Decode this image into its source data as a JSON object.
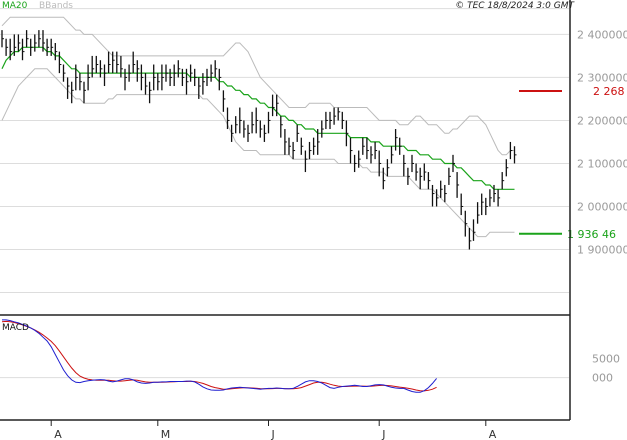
{
  "header": {
    "ma_label": "MA20",
    "bands_label": "BBands",
    "copyright": "© TEC 18/8/2024 3:0 GMT"
  },
  "colors": {
    "ma": "#1aa31a",
    "bands": "#bbbbbb",
    "bars": "#111111",
    "grid": "#dddddd",
    "axis": "#222222",
    "macd_line": "#1f1fd0",
    "macd_signal": "#cc1111",
    "hi_marker": "#cc1111",
    "lo_marker": "#1aa31a"
  },
  "markers": {
    "high_value": 2.2685,
    "high_label": "2 268 5",
    "low_value": 1.93646,
    "low_label": "1 936 46"
  },
  "chart_data": [
    {
      "type": "ohlc",
      "title": "",
      "ylim": [
        1.75,
        2.48
      ],
      "yticks": [
        1.9,
        2.0,
        2.1,
        2.2,
        2.3,
        2.4
      ],
      "ytick_labels": [
        "1 900000",
        "2 000000",
        "2 100000",
        "2 200000",
        "2 300000",
        "2 400000"
      ],
      "xtick_labels": [
        "A",
        "M",
        "J",
        "J",
        "A"
      ],
      "xtick_index": [
        12,
        38,
        65,
        92,
        118
      ],
      "close": [
        2.39,
        2.37,
        2.36,
        2.37,
        2.38,
        2.36,
        2.39,
        2.37,
        2.38,
        2.39,
        2.38,
        2.37,
        2.37,
        2.36,
        2.33,
        2.31,
        2.28,
        2.27,
        2.3,
        2.29,
        2.27,
        2.3,
        2.32,
        2.33,
        2.32,
        2.31,
        2.33,
        2.34,
        2.33,
        2.32,
        2.3,
        2.31,
        2.33,
        2.32,
        2.3,
        2.28,
        2.27,
        2.3,
        2.29,
        2.3,
        2.31,
        2.3,
        2.31,
        2.32,
        2.3,
        2.29,
        2.31,
        2.3,
        2.28,
        2.29,
        2.3,
        2.31,
        2.32,
        2.3,
        2.25,
        2.2,
        2.17,
        2.19,
        2.2,
        2.18,
        2.17,
        2.19,
        2.2,
        2.18,
        2.17,
        2.2,
        2.23,
        2.24,
        2.19,
        2.15,
        2.14,
        2.13,
        2.17,
        2.14,
        2.11,
        2.13,
        2.14,
        2.15,
        2.18,
        2.2,
        2.2,
        2.21,
        2.22,
        2.2,
        2.17,
        2.13,
        2.1,
        2.11,
        2.14,
        2.13,
        2.12,
        2.13,
        2.1,
        2.06,
        2.09,
        2.12,
        2.16,
        2.14,
        2.1,
        2.07,
        2.1,
        2.08,
        2.07,
        2.08,
        2.06,
        2.03,
        2.02,
        2.04,
        2.03,
        2.07,
        2.1,
        2.05,
        2.0,
        1.96,
        1.92,
        1.94,
        1.98,
        2.01,
        2.0,
        2.02,
        2.03,
        2.02,
        2.06,
        2.09,
        2.13,
        2.12
      ],
      "high": [
        2.41,
        2.39,
        2.39,
        2.4,
        2.4,
        2.39,
        2.41,
        2.39,
        2.4,
        2.41,
        2.41,
        2.39,
        2.39,
        2.38,
        2.36,
        2.33,
        2.3,
        2.29,
        2.33,
        2.31,
        2.29,
        2.33,
        2.35,
        2.35,
        2.34,
        2.33,
        2.36,
        2.36,
        2.36,
        2.35,
        2.32,
        2.33,
        2.36,
        2.34,
        2.33,
        2.31,
        2.29,
        2.33,
        2.31,
        2.33,
        2.33,
        2.32,
        2.33,
        2.34,
        2.32,
        2.32,
        2.33,
        2.32,
        2.3,
        2.31,
        2.32,
        2.33,
        2.34,
        2.32,
        2.27,
        2.23,
        2.19,
        2.21,
        2.23,
        2.2,
        2.19,
        2.22,
        2.23,
        2.2,
        2.19,
        2.22,
        2.26,
        2.26,
        2.21,
        2.18,
        2.16,
        2.15,
        2.19,
        2.16,
        2.13,
        2.15,
        2.16,
        2.18,
        2.2,
        2.22,
        2.22,
        2.23,
        2.23,
        2.22,
        2.2,
        2.16,
        2.12,
        2.13,
        2.16,
        2.16,
        2.14,
        2.15,
        2.13,
        2.09,
        2.11,
        2.14,
        2.18,
        2.16,
        2.12,
        2.09,
        2.12,
        2.1,
        2.09,
        2.1,
        2.08,
        2.05,
        2.04,
        2.06,
        2.05,
        2.09,
        2.12,
        2.08,
        2.03,
        1.99,
        1.95,
        1.97,
        2.01,
        2.03,
        2.02,
        2.04,
        2.05,
        2.04,
        2.08,
        2.11,
        2.15,
        2.14
      ],
      "low": [
        2.37,
        2.35,
        2.34,
        2.35,
        2.36,
        2.34,
        2.37,
        2.35,
        2.36,
        2.37,
        2.36,
        2.35,
        2.35,
        2.34,
        2.31,
        2.29,
        2.25,
        2.24,
        2.27,
        2.27,
        2.24,
        2.27,
        2.3,
        2.31,
        2.3,
        2.28,
        2.31,
        2.31,
        2.31,
        2.3,
        2.27,
        2.29,
        2.31,
        2.29,
        2.27,
        2.26,
        2.24,
        2.27,
        2.27,
        2.27,
        2.29,
        2.28,
        2.28,
        2.3,
        2.28,
        2.26,
        2.29,
        2.28,
        2.25,
        2.26,
        2.28,
        2.29,
        2.3,
        2.27,
        2.22,
        2.18,
        2.15,
        2.17,
        2.17,
        2.16,
        2.15,
        2.17,
        2.17,
        2.16,
        2.15,
        2.17,
        2.21,
        2.21,
        2.16,
        2.12,
        2.12,
        2.11,
        2.15,
        2.12,
        2.08,
        2.11,
        2.12,
        2.12,
        2.16,
        2.18,
        2.18,
        2.19,
        2.2,
        2.18,
        2.14,
        2.1,
        2.08,
        2.09,
        2.12,
        2.11,
        2.1,
        2.11,
        2.07,
        2.04,
        2.07,
        2.1,
        2.13,
        2.12,
        2.07,
        2.05,
        2.08,
        2.06,
        2.04,
        2.06,
        2.04,
        2.0,
        2.0,
        2.02,
        2.01,
        2.05,
        2.08,
        2.02,
        1.98,
        1.93,
        1.9,
        1.92,
        1.96,
        1.98,
        1.98,
        2.0,
        2.01,
        2.0,
        2.04,
        2.07,
        2.11,
        2.1
      ],
      "ma20": [
        2.32,
        2.34,
        2.35,
        2.36,
        2.36,
        2.37,
        2.37,
        2.37,
        2.37,
        2.37,
        2.37,
        2.36,
        2.36,
        2.35,
        2.35,
        2.34,
        2.33,
        2.32,
        2.32,
        2.31,
        2.31,
        2.31,
        2.31,
        2.31,
        2.31,
        2.31,
        2.31,
        2.31,
        2.31,
        2.31,
        2.31,
        2.31,
        2.31,
        2.31,
        2.31,
        2.31,
        2.31,
        2.31,
        2.31,
        2.31,
        2.31,
        2.31,
        2.31,
        2.31,
        2.31,
        2.31,
        2.3,
        2.3,
        2.3,
        2.3,
        2.3,
        2.3,
        2.3,
        2.29,
        2.29,
        2.28,
        2.28,
        2.27,
        2.27,
        2.26,
        2.26,
        2.25,
        2.25,
        2.24,
        2.24,
        2.23,
        2.23,
        2.22,
        2.21,
        2.21,
        2.2,
        2.2,
        2.19,
        2.19,
        2.18,
        2.18,
        2.18,
        2.17,
        2.17,
        2.17,
        2.17,
        2.17,
        2.17,
        2.17,
        2.17,
        2.16,
        2.16,
        2.16,
        2.16,
        2.16,
        2.15,
        2.15,
        2.15,
        2.14,
        2.14,
        2.14,
        2.14,
        2.14,
        2.14,
        2.13,
        2.13,
        2.13,
        2.12,
        2.12,
        2.12,
        2.11,
        2.11,
        2.11,
        2.1,
        2.1,
        2.1,
        2.09,
        2.09,
        2.08,
        2.07,
        2.06,
        2.06,
        2.06,
        2.05,
        2.05,
        2.04,
        2.04,
        2.04,
        2.04,
        2.04,
        2.04
      ],
      "upper_band": [
        2.42,
        2.43,
        2.44,
        2.44,
        2.44,
        2.44,
        2.44,
        2.44,
        2.44,
        2.44,
        2.44,
        2.44,
        2.44,
        2.44,
        2.44,
        2.44,
        2.43,
        2.42,
        2.41,
        2.41,
        2.4,
        2.4,
        2.4,
        2.39,
        2.38,
        2.37,
        2.36,
        2.35,
        2.35,
        2.35,
        2.35,
        2.35,
        2.35,
        2.35,
        2.35,
        2.35,
        2.35,
        2.35,
        2.35,
        2.35,
        2.35,
        2.35,
        2.35,
        2.35,
        2.35,
        2.35,
        2.35,
        2.35,
        2.35,
        2.35,
        2.35,
        2.35,
        2.35,
        2.35,
        2.35,
        2.36,
        2.37,
        2.38,
        2.38,
        2.37,
        2.36,
        2.34,
        2.32,
        2.3,
        2.29,
        2.28,
        2.27,
        2.26,
        2.25,
        2.24,
        2.23,
        2.23,
        2.23,
        2.23,
        2.23,
        2.24,
        2.24,
        2.24,
        2.24,
        2.24,
        2.24,
        2.23,
        2.23,
        2.23,
        2.23,
        2.23,
        2.23,
        2.23,
        2.23,
        2.23,
        2.22,
        2.21,
        2.2,
        2.2,
        2.2,
        2.2,
        2.2,
        2.19,
        2.19,
        2.19,
        2.2,
        2.21,
        2.21,
        2.2,
        2.19,
        2.19,
        2.19,
        2.18,
        2.17,
        2.17,
        2.18,
        2.18,
        2.19,
        2.2,
        2.21,
        2.21,
        2.21,
        2.2,
        2.19,
        2.17,
        2.15,
        2.13,
        2.12,
        2.12,
        2.13,
        2.13
      ],
      "lower_band": [
        2.2,
        2.22,
        2.24,
        2.26,
        2.28,
        2.29,
        2.3,
        2.31,
        2.32,
        2.32,
        2.32,
        2.32,
        2.31,
        2.3,
        2.29,
        2.28,
        2.27,
        2.26,
        2.25,
        2.25,
        2.24,
        2.24,
        2.24,
        2.24,
        2.24,
        2.24,
        2.25,
        2.25,
        2.26,
        2.26,
        2.26,
        2.26,
        2.26,
        2.26,
        2.26,
        2.26,
        2.26,
        2.26,
        2.26,
        2.26,
        2.26,
        2.26,
        2.26,
        2.26,
        2.26,
        2.26,
        2.26,
        2.26,
        2.26,
        2.25,
        2.25,
        2.24,
        2.23,
        2.22,
        2.21,
        2.19,
        2.17,
        2.15,
        2.14,
        2.13,
        2.13,
        2.13,
        2.13,
        2.12,
        2.12,
        2.12,
        2.12,
        2.12,
        2.12,
        2.12,
        2.12,
        2.11,
        2.11,
        2.11,
        2.11,
        2.11,
        2.11,
        2.11,
        2.11,
        2.11,
        2.11,
        2.11,
        2.1,
        2.1,
        2.1,
        2.1,
        2.1,
        2.1,
        2.09,
        2.09,
        2.08,
        2.08,
        2.08,
        2.08,
        2.07,
        2.07,
        2.07,
        2.07,
        2.07,
        2.07,
        2.06,
        2.05,
        2.04,
        2.04,
        2.04,
        2.04,
        2.03,
        2.02,
        2.01,
        2.0,
        1.99,
        1.98,
        1.97,
        1.96,
        1.95,
        1.94,
        1.93,
        1.93,
        1.93,
        1.94,
        1.94,
        1.94,
        1.94,
        1.94,
        1.94,
        1.94
      ]
    },
    {
      "type": "line",
      "title": "MACD",
      "ylim": [
        -1100,
        1600
      ],
      "yticks": [
        500,
        0
      ],
      "ytick_labels": [
        "5000",
        "000"
      ],
      "series": [
        {
          "values": [
            1500,
            1500,
            1480,
            1450,
            1420,
            1380,
            1340,
            1290,
            1230,
            1150,
            1050,
            950,
            800,
            600,
            400,
            200,
            50,
            -60,
            -120,
            -130,
            -100,
            -80,
            -70,
            -60,
            -50,
            -60,
            -90,
            -110,
            -90,
            -60,
            -30,
            -30,
            -60,
            -110,
            -140,
            -150,
            -140,
            -120,
            -120,
            -110,
            -110,
            -100,
            -100,
            -100,
            -100,
            -90,
            -90,
            -110,
            -170,
            -240,
            -290,
            -320,
            -330,
            -330,
            -320,
            -290,
            -270,
            -260,
            -250,
            -260,
            -270,
            -280,
            -290,
            -300,
            -290,
            -280,
            -280,
            -270,
            -280,
            -290,
            -290,
            -280,
            -230,
            -170,
            -110,
            -80,
            -80,
            -100,
            -140,
            -200,
            -260,
            -280,
            -250,
            -230,
            -220,
            -210,
            -200,
            -210,
            -230,
            -230,
            -210,
            -190,
            -180,
            -190,
            -220,
            -250,
            -270,
            -280,
            -280,
            -320,
            -360,
            -380,
            -380,
            -340,
            -260,
            -150,
            -20
          ]
        },
        {
          "values": [
            1450,
            1460,
            1450,
            1430,
            1400,
            1370,
            1330,
            1290,
            1240,
            1180,
            1110,
            1030,
            940,
            830,
            690,
            540,
            390,
            250,
            130,
            40,
            -10,
            -40,
            -60,
            -70,
            -70,
            -70,
            -70,
            -80,
            -90,
            -90,
            -80,
            -70,
            -60,
            -70,
            -90,
            -110,
            -120,
            -120,
            -120,
            -120,
            -115,
            -110,
            -105,
            -100,
            -100,
            -100,
            -95,
            -100,
            -120,
            -150,
            -190,
            -230,
            -260,
            -280,
            -300,
            -300,
            -290,
            -280,
            -270,
            -265,
            -265,
            -270,
            -275,
            -285,
            -290,
            -290,
            -285,
            -280,
            -280,
            -285,
            -290,
            -290,
            -280,
            -260,
            -220,
            -180,
            -140,
            -120,
            -120,
            -140,
            -170,
            -200,
            -220,
            -230,
            -230,
            -225,
            -220,
            -220,
            -220,
            -225,
            -225,
            -215,
            -205,
            -200,
            -205,
            -215,
            -230,
            -245,
            -260,
            -275,
            -295,
            -320,
            -340,
            -345,
            -330,
            -300,
            -250
          ]
        }
      ]
    }
  ]
}
